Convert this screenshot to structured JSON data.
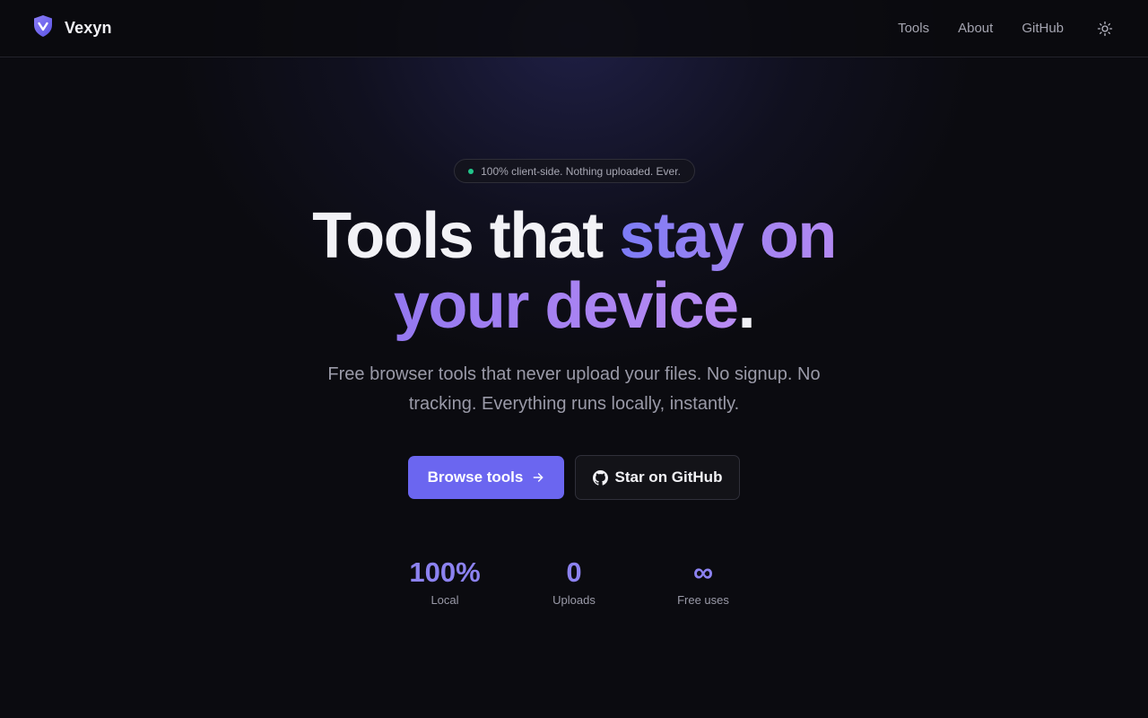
{
  "header": {
    "brand_name": "Vexyn",
    "nav": [
      {
        "label": "Tools"
      },
      {
        "label": "About"
      },
      {
        "label": "GitHub"
      }
    ],
    "theme_icon": "sun-icon"
  },
  "hero": {
    "badge": "100% client-side. Nothing uploaded. Ever.",
    "title_part1": "Tools that ",
    "title_highlight1": "stay on",
    "title_highlight2": "your device",
    "title_end": ".",
    "subtitle": "Free browser tools that never upload your files. No signup. No tracking. Everything runs locally, instantly.",
    "primary_button": "Browse tools",
    "secondary_button": "Star on GitHub",
    "stats": [
      {
        "value": "100%",
        "label": "Local"
      },
      {
        "value": "0",
        "label": "Uploads"
      },
      {
        "value": "∞",
        "label": "Free uses"
      }
    ]
  },
  "colors": {
    "background": "#0b0b10",
    "accent": "#6b66f0",
    "badge_dot": "#22c58b"
  }
}
